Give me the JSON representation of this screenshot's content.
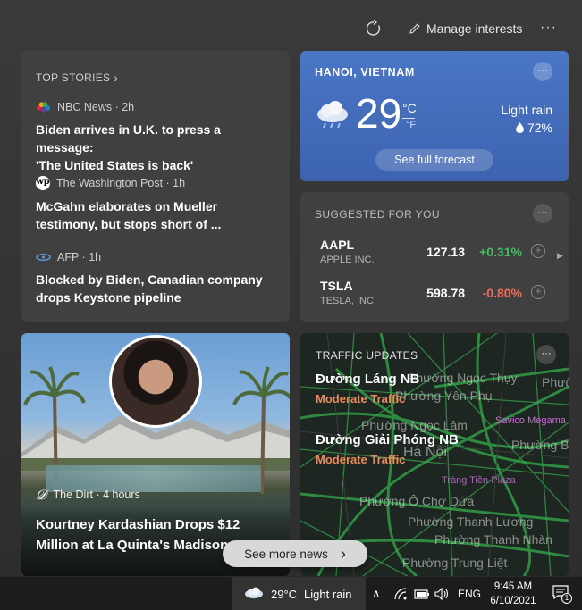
{
  "header": {
    "refresh_icon": "refresh-icon",
    "manage_label": "Manage interests",
    "more_label": "···"
  },
  "top_stories": {
    "heading": "TOP STORIES",
    "chevron": "›",
    "stories": [
      {
        "source": "NBC News · 2h",
        "title_line1": "Biden arrives in U.K. to press a message:",
        "title_line2": "'The United States is back'"
      },
      {
        "source": "The Washington Post · 1h",
        "title_line1": "McGahn elaborates on Mueller",
        "title_line2": "testimony, but stops short of ..."
      },
      {
        "source": "AFP · 1h",
        "title_line1": "Blocked by Biden, Canadian company",
        "title_line2": "drops Keystone pipeline"
      }
    ]
  },
  "weather": {
    "location": "HANOI, VIETNAM",
    "more": "···",
    "temperature": "29",
    "unit_c": "°C",
    "unit_f": "°F",
    "condition": "Light rain",
    "humidity": "72%",
    "forecast_button": "See full forecast"
  },
  "suggested": {
    "heading": "SUGGESTED FOR YOU",
    "more": "···",
    "next": "▶",
    "stocks": [
      {
        "symbol": "AAPL",
        "name": "APPLE INC.",
        "price": "127.13",
        "change": "+0.31%",
        "change_color": "#3fbf5f",
        "add": "+"
      },
      {
        "symbol": "TSLA",
        "name": "TESLA, INC.",
        "price": "598.78",
        "change": "-0.80%",
        "change_color": "#f06a5a",
        "add": "+"
      }
    ]
  },
  "news_card": {
    "source": "The Dirt · 4 hours",
    "source_logo": "𝓓",
    "title_line1": "Kourtney Kardashian Drops $12",
    "title_line2": "Million at La Quinta's Madison..."
  },
  "traffic": {
    "heading": "TRAFFIC UPDATES",
    "more": "···",
    "roads": [
      {
        "name": "Đường Láng NB",
        "status": "Moderate Traffic"
      },
      {
        "name": "Đường Giải Phóng NB",
        "status": "Moderate Traffic"
      }
    ],
    "map_labels": {
      "l1": "Phường Ngọc Thụy",
      "l2": "Phường Yên Phụ",
      "l3": "Phường Ngọc Lâm",
      "l4": "Hà Nội",
      "l5": "Phường Bồ Đề",
      "l6": "Phường Ô Chợ Dừa",
      "l7": "Phường Thanh Lương",
      "l8": "Phường Thanh Nhàn",
      "l9": "Phường Trung Liệt",
      "l10": "Phườ",
      "poi1": "Savico Megama",
      "poi2": "Tràng Tiền Plaza"
    }
  },
  "see_more": {
    "label": "See more news",
    "chevron": "›"
  },
  "taskbar": {
    "weather_temp": "29°C",
    "weather_cond": "Light rain",
    "chevron_up": "∧",
    "lang": "ENG",
    "time": "9:45 AM",
    "date": "6/10/2021",
    "notification_count": "1"
  }
}
